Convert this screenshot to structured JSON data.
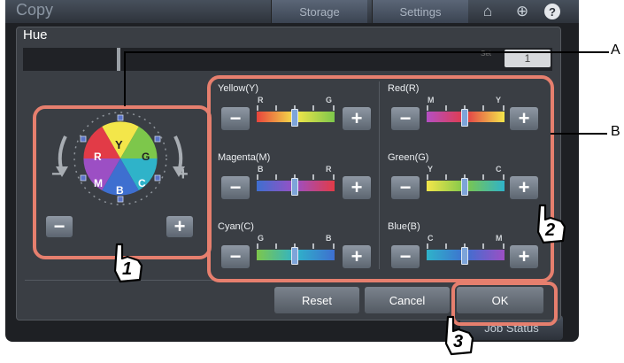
{
  "topbar": {
    "app_title": "Copy",
    "tab_storage": "Storage",
    "tab_settings": "Settings",
    "icons": [
      "home-icon",
      "globe-icon",
      "help-icon"
    ]
  },
  "dialog": {
    "title": "Hue",
    "strip_set_label": "Set",
    "strip_value": "1"
  },
  "wheel": {
    "letters": [
      "R",
      "Y",
      "G",
      "C",
      "B",
      "M"
    ],
    "minus_sign": "−",
    "plus_sign": "+"
  },
  "sliders": [
    {
      "name": "Yellow(Y)",
      "left_tick": "R",
      "right_tick": "G"
    },
    {
      "name": "Red(R)",
      "left_tick": "M",
      "right_tick": "Y"
    },
    {
      "name": "Magenta(M)",
      "left_tick": "B",
      "right_tick": "R"
    },
    {
      "name": "Green(G)",
      "left_tick": "Y",
      "right_tick": "C"
    },
    {
      "name": "Cyan(C)",
      "left_tick": "G",
      "right_tick": "B"
    },
    {
      "name": "Blue(B)",
      "left_tick": "C",
      "right_tick": "M"
    }
  ],
  "buttons": {
    "reset": "Reset",
    "cancel": "Cancel",
    "ok": "OK"
  },
  "footer": {
    "job_status": "Job Status"
  },
  "callouts": {
    "a": "A",
    "b": "B",
    "step1": "1",
    "step2": "2",
    "step3": "3"
  },
  "colors": {
    "highlight": "#e67f6e",
    "dialog_bg": "#3a3e44",
    "knob": "#7da4d9"
  }
}
